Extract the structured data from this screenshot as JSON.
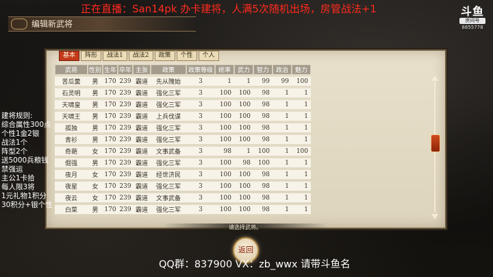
{
  "stream_title": "正在直播：San14pk 办卡建将，人满5次随机出场，房管战法+1",
  "logo": {
    "main": "斗鱼",
    "tag": "房间号",
    "room": "8855778"
  },
  "panel_title": "编辑新武将",
  "tabs": [
    "基本",
    "阵形",
    "战法1",
    "战法2",
    "政策",
    "个性",
    "个人"
  ],
  "table": {
    "headers": [
      "武将",
      "性别",
      "生年",
      "卒年",
      "主张",
      "政策",
      "政策等级",
      "统率",
      "武力",
      "智力",
      "政治",
      "魅力"
    ],
    "rows": [
      [
        "苦瓜羹",
        "男",
        "170",
        "239",
        "霸道",
        "先从隗始",
        "3",
        "1",
        "1",
        "99",
        "99",
        "100"
      ],
      [
        "石灵明",
        "男",
        "170",
        "239",
        "霸道",
        "强化三军",
        "3",
        "100",
        "100",
        "98",
        "1",
        "1"
      ],
      [
        "天啸皇",
        "男",
        "170",
        "239",
        "霸道",
        "强化三军",
        "3",
        "100",
        "100",
        "98",
        "1",
        "1"
      ],
      [
        "天啸王",
        "男",
        "170",
        "239",
        "霸道",
        "上兵伐谋",
        "3",
        "100",
        "100",
        "98",
        "1",
        "1"
      ],
      [
        "孤独",
        "男",
        "170",
        "239",
        "霸道",
        "强化三军",
        "3",
        "100",
        "100",
        "98",
        "1",
        "1"
      ],
      [
        "青衫",
        "男",
        "170",
        "239",
        "霸道",
        "强化三军",
        "3",
        "100",
        "100",
        "98",
        "1",
        "1"
      ],
      [
        "奇葩",
        "女",
        "170",
        "239",
        "霸道",
        "文事武备",
        "3",
        "98",
        "1",
        "100",
        "1",
        "100"
      ],
      [
        "倔强",
        "男",
        "170",
        "239",
        "霸道",
        "强化三军",
        "3",
        "100",
        "98",
        "100",
        "1",
        "1"
      ],
      [
        "夜月",
        "女",
        "170",
        "239",
        "霸道",
        "经世济民",
        "3",
        "100",
        "100",
        "98",
        "1",
        "1"
      ],
      [
        "夜星",
        "女",
        "170",
        "239",
        "霸道",
        "强化三军",
        "3",
        "100",
        "100",
        "98",
        "1",
        "1"
      ],
      [
        "夜云",
        "女",
        "170",
        "239",
        "霸道",
        "文事武备",
        "3",
        "100",
        "100",
        "98",
        "1",
        "1"
      ],
      [
        "白菜",
        "男",
        "170",
        "239",
        "霸道",
        "强化三军",
        "3",
        "100",
        "100",
        "98",
        "1",
        "1"
      ]
    ]
  },
  "rules": [
    "建将规则:",
    "综合属性300点",
    "个性1金2银",
    "战法1个",
    "阵型2个",
    "送5000兵粮钱",
    "禁强运",
    "主公1卡拾",
    "每人限3将",
    "1元礼物1积分",
    "30积分+银个性"
  ],
  "prompt": "请选择武将。",
  "back_label": "返回",
  "footer": "QQ群：837900 VX：zb_wwx 请带斗鱼名",
  "colors": {
    "tab_active": "#c23a1a",
    "header_bg": "#a39b8b",
    "stream_title": "#ff2a1e"
  }
}
